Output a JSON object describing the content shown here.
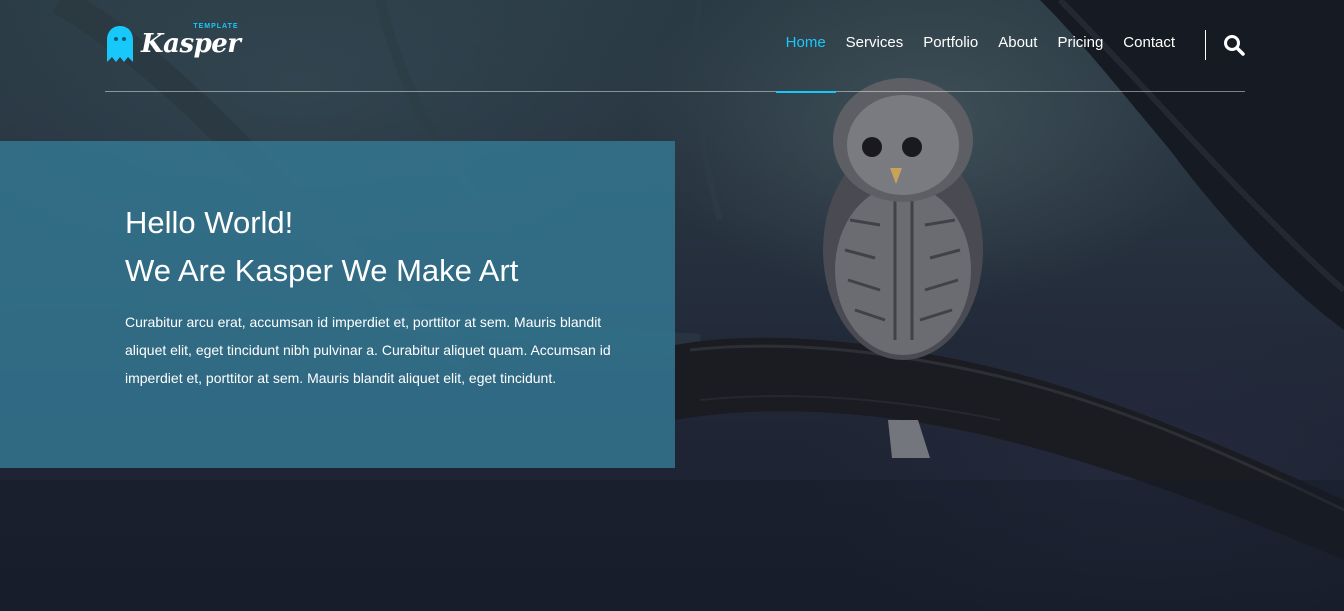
{
  "header": {
    "logo": {
      "wordmark": "Kasper",
      "tag": "TEMPLATE"
    },
    "nav": [
      {
        "label": "Home"
      },
      {
        "label": "Services"
      },
      {
        "label": "Portfolio"
      },
      {
        "label": "About"
      },
      {
        "label": "Pricing"
      },
      {
        "label": "Contact"
      }
    ],
    "active_nav": "Home",
    "search_icon": "search-icon"
  },
  "hero": {
    "title_line1": "Hello World!",
    "title_line2": "We Are Kasper We Make Art",
    "text": "Curabitur arcu erat, accumsan id imperdiet et, porttitor at sem. Mauris blandit aliquet elit, eget tincidunt nibh pulvinar a. Curabitur aliquet quam. Accumsan id imperdiet et, porttitor at sem. Mauris blandit aliquet elit, eget tincidunt."
  },
  "colors": {
    "accent": "#19c8fa",
    "hero_box": "#347c98"
  }
}
